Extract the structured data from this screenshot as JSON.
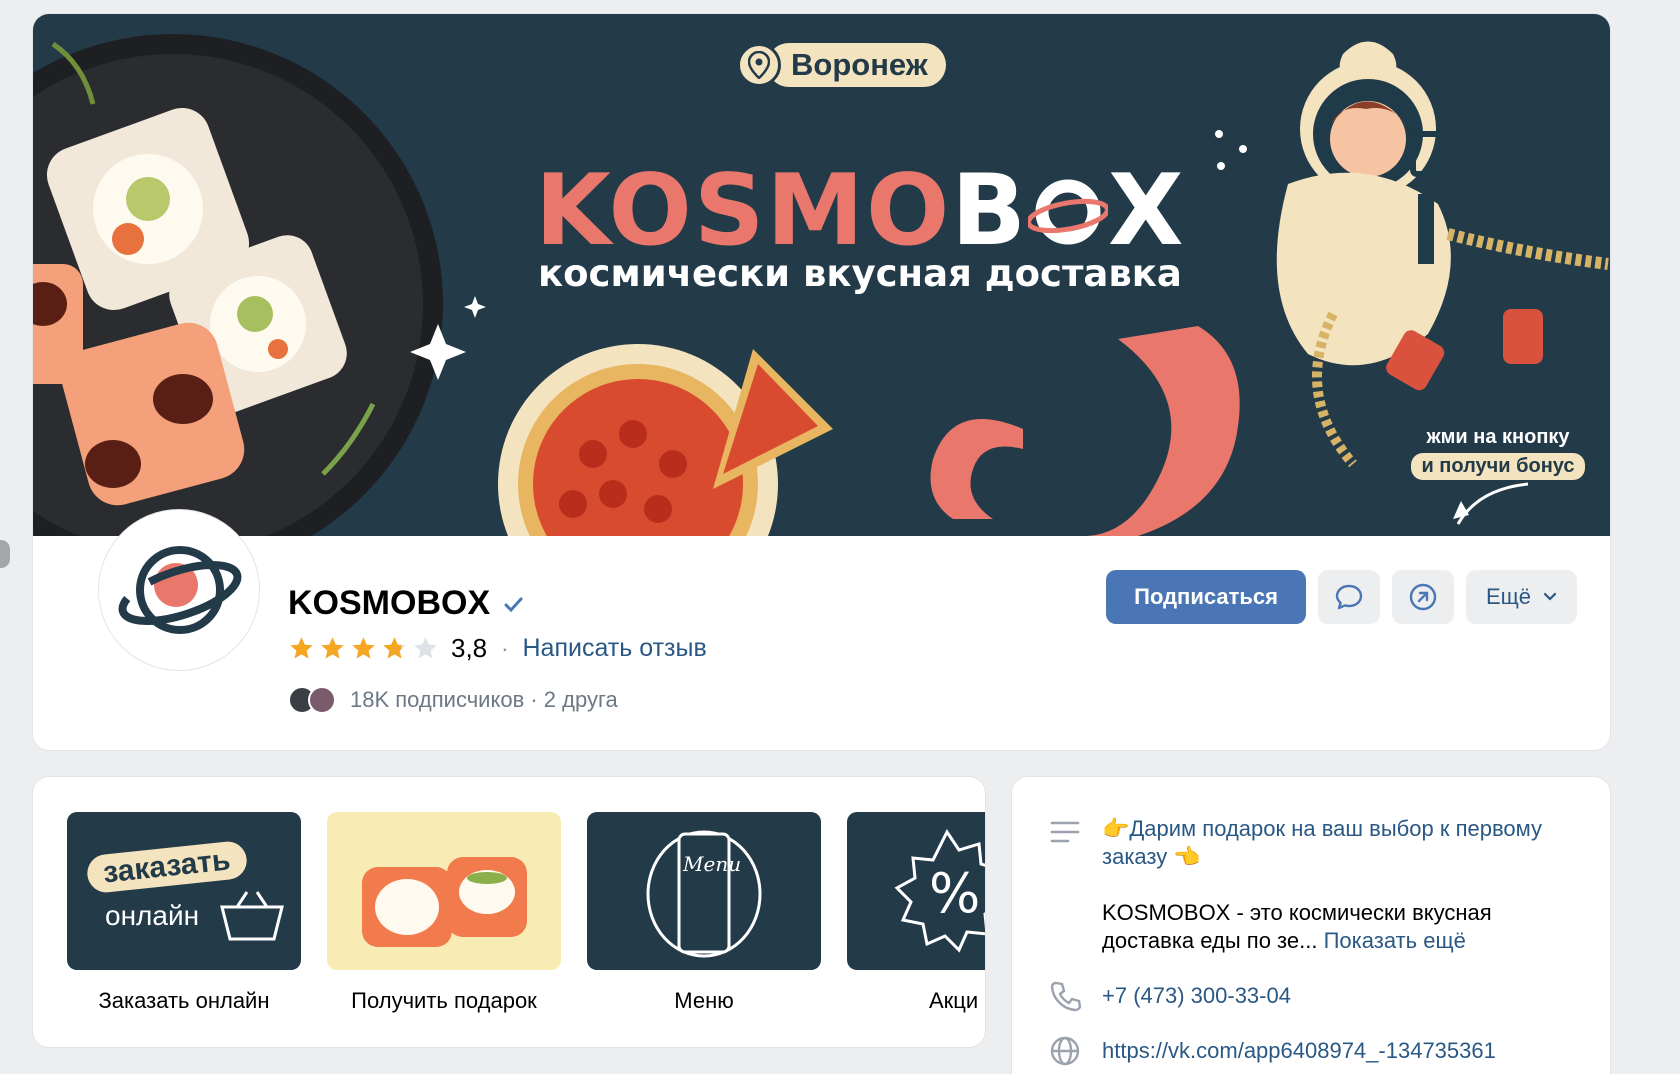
{
  "cover": {
    "city": "Воронеж",
    "brand_part1": "KOSMO",
    "brand_part2": "B",
    "brand_part3": "X",
    "tagline": "космически вкусная доставка",
    "promo_line1": "жми на кнопку",
    "promo_line2": "и получи бонус"
  },
  "profile": {
    "name": "KOSMOBOX",
    "verified": true,
    "rating": "3,8",
    "rating_value": 3.8,
    "rating_max": 5,
    "review_link": "Написать отзыв",
    "followers_count": "18K",
    "followers_text": "18K подписчиков · 2 друга",
    "separator": "·"
  },
  "actions": {
    "subscribe": "Подписаться",
    "message_icon": "message-icon",
    "share_icon": "share-icon",
    "more": "Ещё"
  },
  "apps": [
    {
      "label": "Заказать онлайн",
      "thumb_text_1": "заказать",
      "thumb_text_2": "онлайн"
    },
    {
      "label": "Получить подарок"
    },
    {
      "label": "Меню",
      "thumb_text": "Menu"
    },
    {
      "label": "Акци"
    }
  ],
  "about": {
    "headline": "👉Дарим подарок на ваш выбор к первому заказу 👈",
    "description": "KOSMOBOX - это космически вкусная доставка еды по зе...",
    "show_more": "Показать ещё",
    "phone": "+7 (473) 300-33-04",
    "link": "https://vk.com/app6408974_-134735361"
  },
  "colors": {
    "cover_bg": "#233a49",
    "brand_coral": "#e9776c",
    "cream": "#f3e3bf",
    "primary_button": "#4a76b5",
    "link": "#2a5885"
  }
}
